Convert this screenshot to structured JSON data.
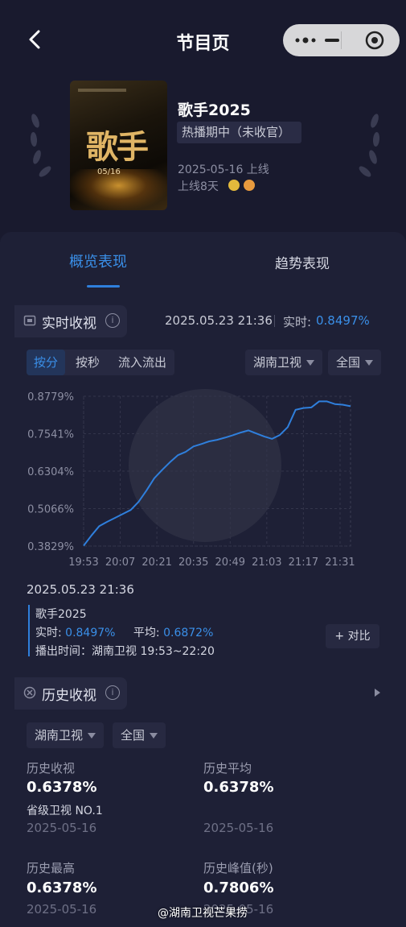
{
  "header": {
    "title": "节目页",
    "back_icon": "back-arrow-icon"
  },
  "program": {
    "poster_text": "歌手",
    "poster_date": "05/16",
    "name": "歌手2025",
    "status": "热播期中（未收官）",
    "release": "2025-05-16 上线",
    "online_days": "上线8天"
  },
  "tabs": [
    {
      "label": "概览表现",
      "active": true
    },
    {
      "label": "趋势表现",
      "active": false
    }
  ],
  "realtime": {
    "title": "实时收视",
    "timestamp": "2025.05.23 21:36",
    "rt_label": "实时:",
    "rt_value": "0.8497%",
    "segments": [
      "按分",
      "按秒",
      "流入流出"
    ],
    "channel": "湖南卫视",
    "region": "全国"
  },
  "chart_data": {
    "type": "line",
    "x_ticks": [
      "19:53",
      "20:07",
      "20:21",
      "20:35",
      "20:49",
      "21:03",
      "21:17",
      "21:31"
    ],
    "y_ticks": [
      "0.3829%",
      "0.5066%",
      "0.6304%",
      "0.7541%",
      "0.8779%"
    ],
    "ylim": [
      0.3829,
      0.8779
    ],
    "x_minutes_start": "19:53",
    "series": [
      {
        "name": "歌手2025",
        "color": "#2f7fdc",
        "points": [
          [
            "19:53",
            0.384
          ],
          [
            "19:56",
            0.418
          ],
          [
            "19:59",
            0.449
          ],
          [
            "20:02",
            0.463
          ],
          [
            "20:05",
            0.476
          ],
          [
            "20:08",
            0.489
          ],
          [
            "20:11",
            0.502
          ],
          [
            "20:14",
            0.529
          ],
          [
            "20:17",
            0.566
          ],
          [
            "20:20",
            0.607
          ],
          [
            "20:23",
            0.634
          ],
          [
            "20:26",
            0.66
          ],
          [
            "20:29",
            0.683
          ],
          [
            "20:32",
            0.694
          ],
          [
            "20:35",
            0.712
          ],
          [
            "20:38",
            0.72
          ],
          [
            "20:41",
            0.729
          ],
          [
            "20:44",
            0.734
          ],
          [
            "20:47",
            0.741
          ],
          [
            "20:50",
            0.749
          ],
          [
            "20:53",
            0.758
          ],
          [
            "20:56",
            0.765
          ],
          [
            "20:59",
            0.755
          ],
          [
            "21:02",
            0.745
          ],
          [
            "21:05",
            0.737
          ],
          [
            "21:08",
            0.75
          ],
          [
            "21:11",
            0.776
          ],
          [
            "21:14",
            0.833
          ],
          [
            "21:17",
            0.839
          ],
          [
            "21:20",
            0.841
          ],
          [
            "21:23",
            0.861
          ],
          [
            "21:26",
            0.861
          ],
          [
            "21:29",
            0.852
          ],
          [
            "21:32",
            0.85
          ],
          [
            "21:35",
            0.845
          ]
        ]
      }
    ]
  },
  "detail": {
    "time": "2025.05.23 21:36",
    "name": "歌手2025",
    "rt_label": "实时:",
    "rt_value": "0.8497%",
    "avg_label": "平均:",
    "avg_value": "0.6872%",
    "broadcast": "播出时间：湖南卫视 19:53~22:20",
    "compare": "+ 对比"
  },
  "history": {
    "title": "历史收视",
    "channel": "湖南卫视",
    "region": "全国",
    "stats": [
      {
        "label": "历史收视",
        "value": "0.6378%",
        "rank": "省级卫视 NO.1",
        "date": "2025-05-16"
      },
      {
        "label": "历史平均",
        "value": "0.6378%",
        "date": "2025-05-16"
      },
      {
        "label": "历史最高",
        "value": "0.6378%",
        "date": "2025-05-16"
      },
      {
        "label": "历史峰值(秒)",
        "value": "0.7806%",
        "date": "2025-05-16"
      }
    ]
  },
  "watermark": "@湖南卫视芒果捞",
  "colors": {
    "accent": "#3a8fe8",
    "background": "#191a2e",
    "panel": "#1e2036"
  }
}
